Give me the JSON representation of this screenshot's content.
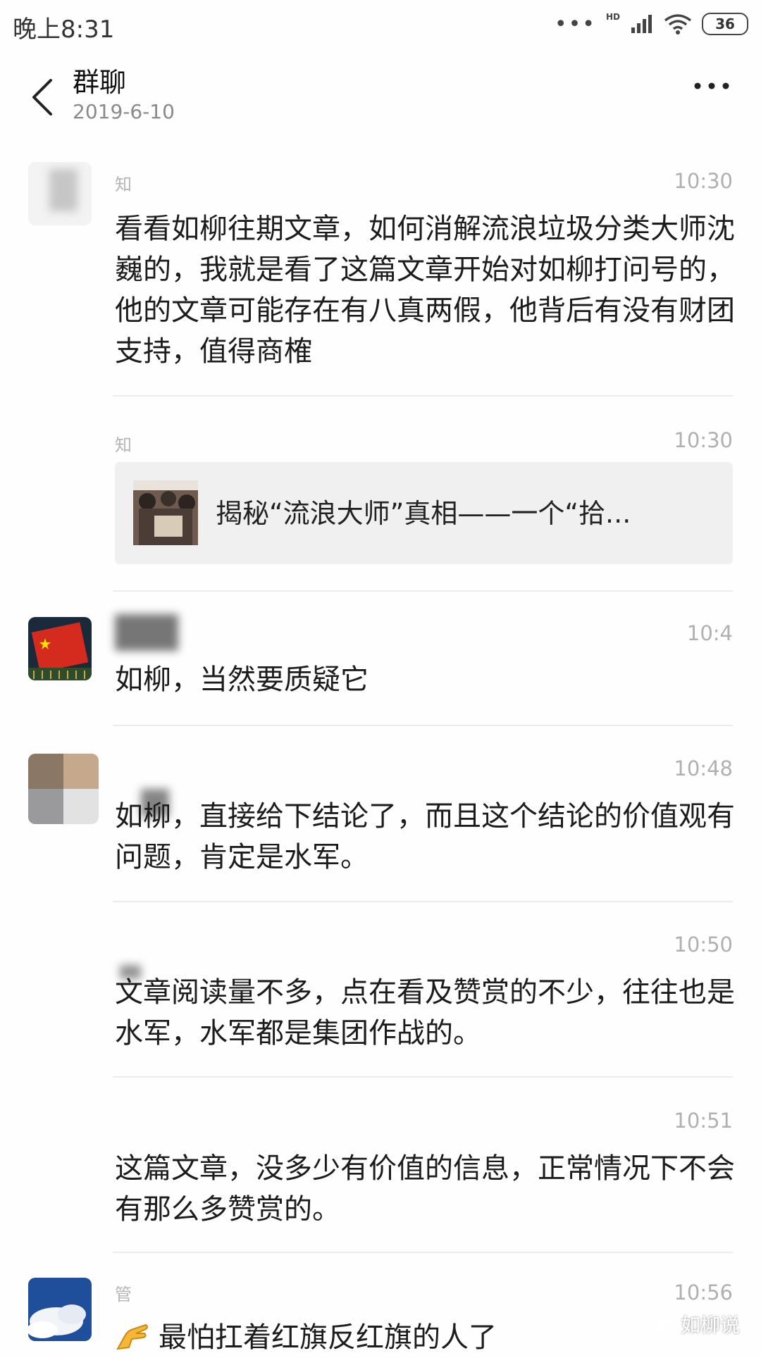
{
  "status_bar": {
    "time": "晚上8:31",
    "network": "HD",
    "battery": "36"
  },
  "header": {
    "title": "群聊",
    "date": "2019-6-10"
  },
  "messages": [
    {
      "sender": "知",
      "time": "10:30",
      "text": "看看如柳往期文章，如何消解流浪垃圾分类大师沈巍的，我就是看了这篇文章开始对如柳打问号的，他的文章可能存在有八真两假，他背后有没有财团支持，值得商榷"
    },
    {
      "sender": "知",
      "time": "10:30",
      "link_title": "揭秘“流浪大师”真相——一个“拾..."
    },
    {
      "sender": "",
      "time": "10:4",
      "text": "如柳，当然要质疑它"
    },
    {
      "sender": "",
      "time": "10:48",
      "text": "如柳，直接给下结论了，而且这个结论的价值观有问题，肯定是水军。"
    },
    {
      "sender": "",
      "time": "10:50",
      "text": "文章阅读量不多，点在看及赞赏的不少，往往也是水军，水军都是集团作战的。"
    },
    {
      "sender": "",
      "time": "10:51",
      "text": "这篇文章，没多少有价值的信息，正常情况下不会有那么多赞赏的。"
    },
    {
      "sender": "管",
      "time": "10:56",
      "text": "最怕扛着红旗反红旗的人了"
    }
  ],
  "watermark": "如柳说",
  "colors": {
    "background": "#fefefe",
    "link_card_bg": "#f0f0f0",
    "divider": "#ececec",
    "timestamp": "#b0b0b0"
  }
}
